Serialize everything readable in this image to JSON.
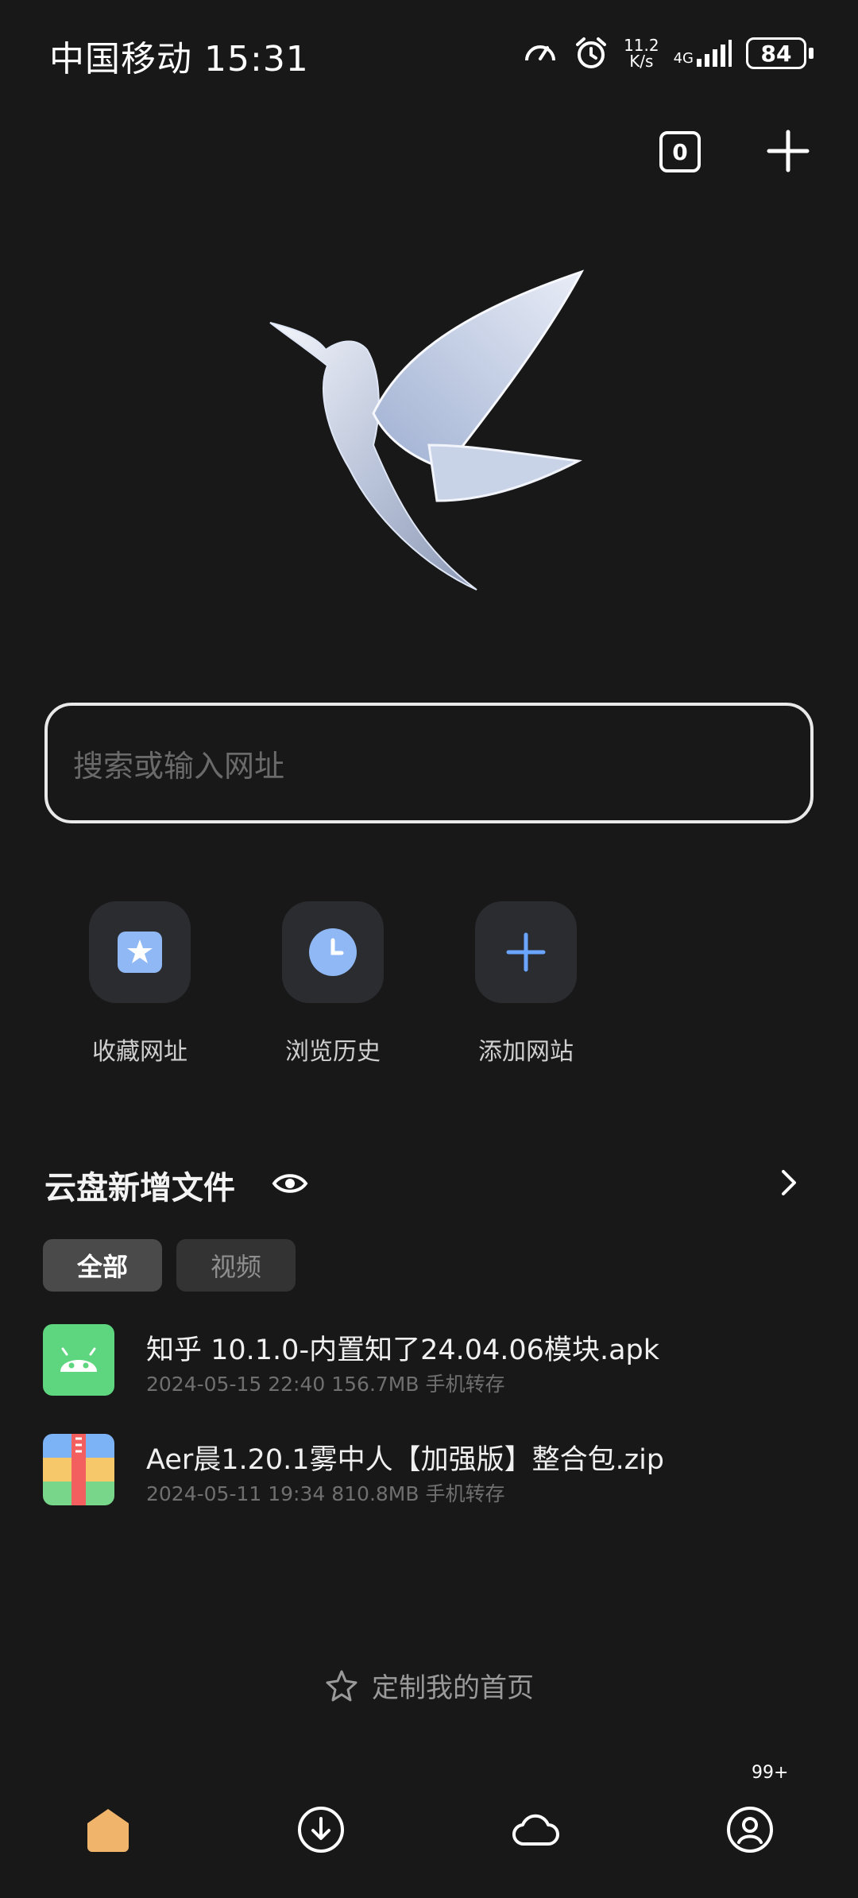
{
  "status_bar": {
    "carrier": "中国移动",
    "time": "15:31",
    "net_speed_value": "11.2",
    "net_speed_unit": "K/s",
    "network": "4G",
    "battery": "84"
  },
  "top_actions": {
    "tab_count": "0"
  },
  "search": {
    "placeholder": "搜索或输入网址"
  },
  "quick_links": [
    {
      "label": "收藏网址",
      "icon": "bookmark-star-icon"
    },
    {
      "label": "浏览历史",
      "icon": "history-clock-icon"
    },
    {
      "label": "添加网站",
      "icon": "plus-icon"
    }
  ],
  "cloud_section": {
    "title": "云盘新增文件",
    "filters": [
      {
        "label": "全部",
        "selected": true
      },
      {
        "label": "视频",
        "selected": false
      }
    ],
    "files": [
      {
        "name": "知乎 10.1.0-内置知了24.04.06模块.apk",
        "date": "2024-05-15 22:40",
        "size": "156.7MB",
        "source": "手机转存",
        "icon": "android-apk-icon"
      },
      {
        "name": "Aer晨1.20.1雾中人【加强版】整合包.zip",
        "date": "2024-05-11 19:34",
        "size": "810.8MB",
        "source": "手机转存",
        "icon": "zip-archive-icon"
      }
    ]
  },
  "customize": {
    "label": "定制我的首页"
  },
  "bottom_nav": {
    "items": [
      "home-icon",
      "download-icon",
      "cloud-icon",
      "profile-icon"
    ],
    "badge": "99+"
  },
  "colors": {
    "background": "#181818",
    "accent": "#6aa6ff",
    "home_active": "#f0b56a"
  }
}
